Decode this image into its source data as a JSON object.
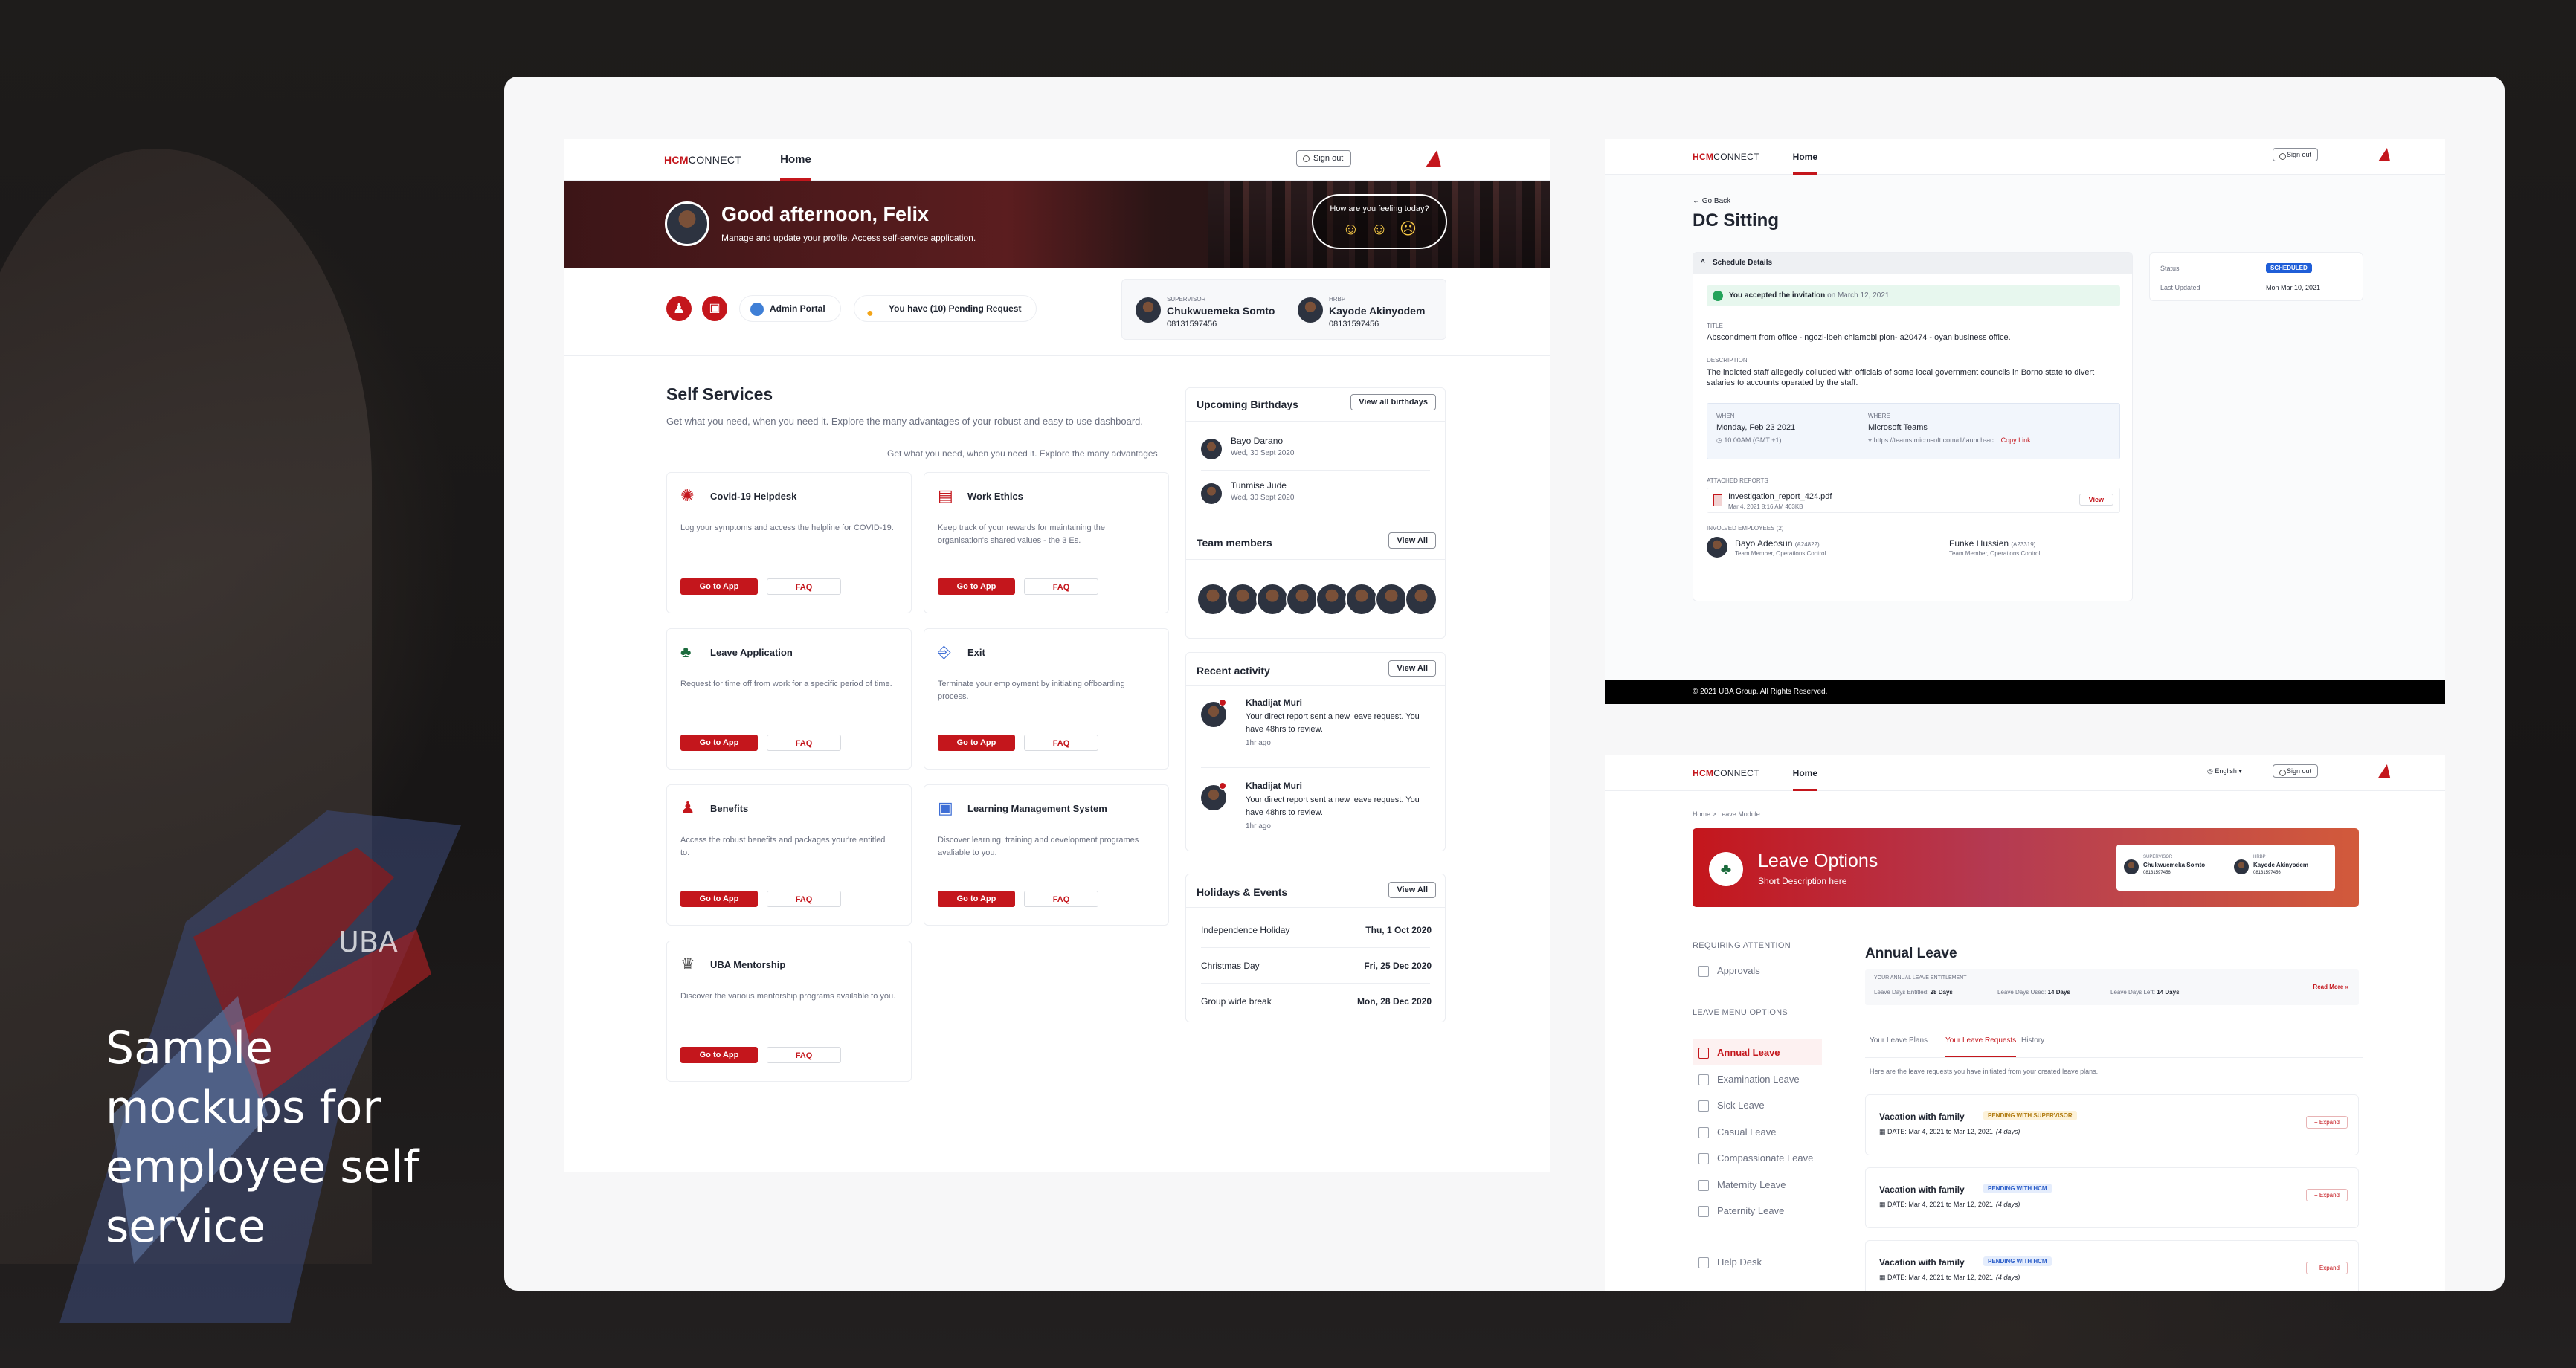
{
  "headline": "Sample mockups for employee self service",
  "colors": {
    "brand": "#c4161c",
    "ink": "#1f2430",
    "muted": "#6b7080"
  },
  "s1": {
    "logo_a": "HCM",
    "logo_b": "CONNECT",
    "nav_home": "Home",
    "signout": "Sign out",
    "greeting": "Good afternoon, Felix",
    "greeting_sub": "Manage and update your profile. Access self-service application.",
    "feeling_q": "How are you feeling today?",
    "admin_portal": "Admin Portal",
    "pending": "You have (10) Pending Request",
    "supervisor_label": "SUPERVISOR",
    "supervisor_name": "Chukwuemeka Somto",
    "supervisor_phone": "08131597456",
    "hrbp_label": "HRBP",
    "hrbp_name": "Kayode Akinyodem",
    "hrbp_phone": "08131597456",
    "ss_title": "Self Services",
    "ss_desc": "Get what you need, when you need it. Explore the many advantages of your robust and easy to use dashboard.",
    "ss_desc2": "Get what you need, when you need it. Explore the many advantages",
    "go": "Go to App",
    "faq": "FAQ",
    "services": [
      {
        "title": "Covid-19 Helpdesk",
        "desc": "Log your symptoms and access the helpline for COVID-19.",
        "icon": "virus-icon"
      },
      {
        "title": "Work Ethics",
        "desc": "Keep track of your rewards for maintaining the organisation's shared values - the 3 Es.",
        "icon": "briefcase-icon"
      },
      {
        "title": "Leave Application",
        "desc": "Request for time off from work for a specific period of time.",
        "icon": "palm-tree-icon"
      },
      {
        "title": "Exit",
        "desc": "Terminate your employment by initiating offboarding process.",
        "icon": "exit-door-icon"
      },
      {
        "title": "Benefits",
        "desc": "Access the robust benefits and packages your're entitled to.",
        "icon": "benefits-icon"
      },
      {
        "title": "Learning Management System",
        "desc": "Discover learning, training and development programes avaliable to you.",
        "icon": "lms-icon"
      },
      {
        "title": "UBA Mentorship",
        "desc": "Discover the various mentorship programs available to you.",
        "icon": "mentorship-icon"
      }
    ],
    "birthdays_title": "Upcoming Birthdays",
    "view_birthdays": "View all birthdays",
    "birthdays": [
      {
        "name": "Bayo Darano",
        "date": "Wed, 30 Sept 2020"
      },
      {
        "name": "Tunmise Jude",
        "date": "Wed, 30 Sept 2020"
      }
    ],
    "team_title": "Team members",
    "view_all": "View All",
    "activity_title": "Recent activity",
    "activity": [
      {
        "name": "Khadijat Muri",
        "text": "Your direct report sent a new leave request. You have 48hrs to review.",
        "time": "1hr ago"
      },
      {
        "name": "Khadijat Muri",
        "text": "Your direct report sent a new leave request. You have 48hrs to review.",
        "time": "1hr ago"
      }
    ],
    "holidays_title": "Holidays & Events",
    "holidays": [
      {
        "name": "Independence Holiday",
        "date": "Thu, 1 Oct 2020"
      },
      {
        "name": "Christmas Day",
        "date": "Fri, 25 Dec 2020"
      },
      {
        "name": "Group wide break",
        "date": "Mon, 28 Dec 2020"
      }
    ]
  },
  "s2": {
    "logo_a": "HCM",
    "logo_b": "CONNECT",
    "nav_home": "Home",
    "signout": "Sign out",
    "back": "Go Back",
    "title": "DC Sitting",
    "section": "Schedule Details",
    "accepted": "You accepted the invitation",
    "accepted_date": "on March 12, 2021",
    "title_label": "TITLE",
    "title_val": "Abscondment from office  - ngozi-ibeh chiamobi pion- a20474 - oyan business office.",
    "desc_label": "DESCRIPTION",
    "desc_val": "The indicted staff allegedly colluded with officials of some local government councils in Borno state to divert salaries to accounts operated by the staff.",
    "when_label": "WHEN",
    "when_val": "Monday, Feb 23 2021",
    "when_time": "10:00AM (GMT +1)",
    "where_label": "WHERE",
    "where_val": "Microsoft Teams",
    "where_url": "https://teams.microsoft.com/dl/launch-ac...",
    "copy_link": "Copy Link",
    "reports_label": "ATTACHED REPORTS",
    "report_name": "Investigation_report_424.pdf",
    "report_meta": "Mar 4, 2021 8:16 AM      403KB",
    "view": "View",
    "involved_label": "INVOLVED EMPLOYEES",
    "involved_count": "(2)",
    "emp1_name": "Bayo Adeosun",
    "emp1_id": "(A24822)",
    "emp1_role": "Team Member, Operations Control",
    "emp2_name": "Funke Hussien",
    "emp2_id": "(A23319)",
    "emp2_role": "Team Member, Operations Control",
    "status_label": "Status",
    "status_val": "SCHEDULED",
    "updated_label": "Last Updated",
    "updated_val": "Mon Mar 10, 2021",
    "footer": "© 2021 UBA Group. All Rights Reserved."
  },
  "s3": {
    "logo_a": "HCM",
    "logo_b": "CONNECT",
    "nav_home": "Home",
    "lang": "English",
    "signout": "Sign out",
    "crumbs": "Home  >  Leave Module",
    "banner_title": "Leave Options",
    "banner_sub": "Short Description here",
    "sup_label": "SUPERVISOR",
    "sup_name": "Chukwuemeka Somto",
    "sup_phone": "08131597456",
    "hrbp_label": "HRBP",
    "hrbp_name": "Kayode Akinyodem",
    "hrbp_phone": "08131597456",
    "req_attention": "REQUIRING ATTENTION",
    "approvals": "Approvals",
    "menu_title": "LEAVE MENU OPTIONS",
    "menu": [
      "Annual Leave",
      "Examination Leave",
      "Sick Leave",
      "Casual Leave",
      "Compassionate Leave",
      "Maternity Leave",
      "Paternity Leave"
    ],
    "help": "Help Desk",
    "section_title": "Annual Leave",
    "ent_label": "YOUR ANNUAL LEAVE ENTITLEMENT",
    "ent1_label": "Leave Days Entitled:",
    "ent1_val": "28 Days",
    "ent2_label": "Leave Days Used:",
    "ent2_val": "14 Days",
    "ent3_label": "Leave Days Left:",
    "ent3_val": "14 Days",
    "read_more": "Read More",
    "tabs": [
      "Your Leave Plans",
      "Your Leave Requests",
      "History"
    ],
    "tab_note": "Here are the leave requests you have initiated from your created leave plans.",
    "expand": "Expand",
    "requests": [
      {
        "title": "Vacation with family",
        "status": "PENDING WITH SUPERVISOR",
        "date": "DATE: Mar 4, 2021 to Mar 12, 2021",
        "days": "(4 days)"
      },
      {
        "title": "Vacation with family",
        "status": "PENDING WITH HCM",
        "date": "DATE: Mar 4, 2021 to Mar 12, 2021",
        "days": "(4 days)"
      },
      {
        "title": "Vacation with family",
        "status": "PENDING WITH HCM",
        "date": "DATE: Mar 4, 2021 to Mar 12, 2021",
        "days": "(4 days)"
      }
    ]
  }
}
